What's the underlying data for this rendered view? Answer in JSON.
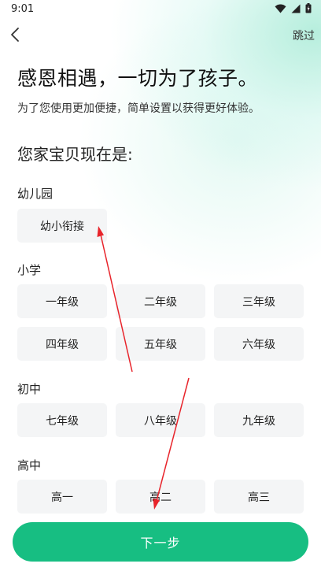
{
  "status_bar": {
    "time": "9:01",
    "wifi_icon": "wifi-icon",
    "signal_icon": "signal-icon",
    "battery_icon": "battery-icon"
  },
  "nav": {
    "back_icon": "chevron-left-icon",
    "skip_label": "跳过"
  },
  "headline": "感恩相遇，一切为了孩子。",
  "subline": "为了您使用更加便捷，简单设置以获得更好体验。",
  "question": "您家宝贝现在是:",
  "sections": [
    {
      "label": "幼儿园",
      "options": [
        "幼小衔接"
      ]
    },
    {
      "label": "小学",
      "options": [
        "一年级",
        "二年级",
        "三年级",
        "四年级",
        "五年级",
        "六年级"
      ]
    },
    {
      "label": "初中",
      "options": [
        "七年级",
        "八年级",
        "九年级"
      ]
    },
    {
      "label": "高中",
      "options": [
        "高一",
        "高二",
        "高三"
      ]
    }
  ],
  "next_button": "下一步",
  "colors": {
    "accent": "#17be82",
    "annotation_arrow": "#e8242b",
    "option_bg": "#f4f5f6"
  }
}
